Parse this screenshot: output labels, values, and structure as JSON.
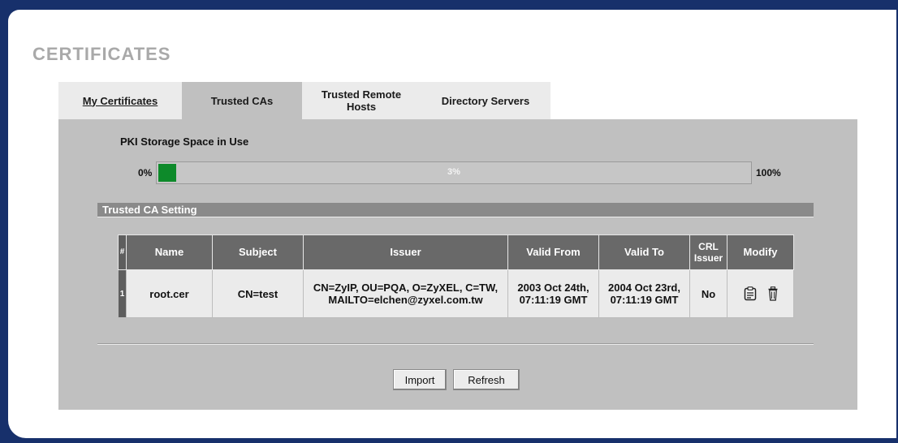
{
  "page": {
    "title": "CERTIFICATES"
  },
  "tabs": [
    {
      "label": "My Certificates",
      "active": false
    },
    {
      "label": "Trusted CAs",
      "active": true
    },
    {
      "label": "Trusted Remote Hosts",
      "active": false
    },
    {
      "label": "Directory Servers",
      "active": false
    }
  ],
  "storage": {
    "label": "PKI Storage Space in Use",
    "min_label": "0%",
    "max_label": "100%",
    "value_text": "3%",
    "fill_fraction": 0.03,
    "fill_color": "#0d8a2a"
  },
  "section": {
    "title": "Trusted CA Setting"
  },
  "table": {
    "headers": {
      "num": "#",
      "name": "Name",
      "subject": "Subject",
      "issuer": "Issuer",
      "valid_from": "Valid From",
      "valid_to": "Valid To",
      "crl_issuer": "CRL Issuer",
      "modify": "Modify"
    },
    "rows": [
      {
        "num": "1",
        "name": "root.cer",
        "subject": "CN=test",
        "issuer": "CN=ZyIP, OU=PQA, O=ZyXEL, C=TW, MAILTO=elchen@zyxel.com.tw",
        "valid_from": "2003 Oct 24th, 07:11:19 GMT",
        "valid_to": "2004 Oct 23rd, 07:11:19 GMT",
        "crl_issuer": "No",
        "modify_icons": [
          "edit-icon",
          "delete-icon"
        ]
      }
    ]
  },
  "buttons": {
    "import": "Import",
    "refresh": "Refresh"
  },
  "colors": {
    "frame": "#17306b",
    "content_bg": "#c0c0c0",
    "header_bg": "#696969",
    "progress": "#0d8a2a"
  }
}
